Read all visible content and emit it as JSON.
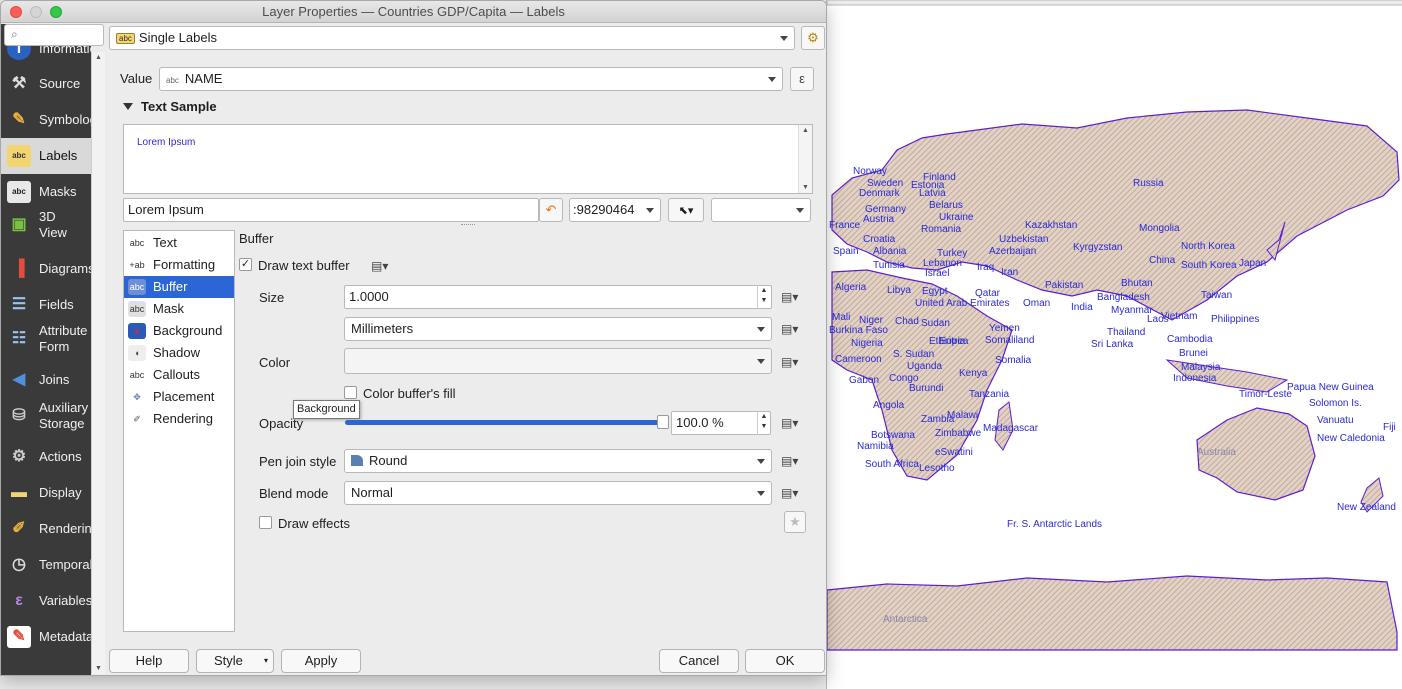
{
  "window": {
    "title": "Layer Properties — Countries GDP/Capita — Labels"
  },
  "sidebar": {
    "items": [
      {
        "label": "Information",
        "icon": "info-icon"
      },
      {
        "label": "Source",
        "icon": "wrench-icon"
      },
      {
        "label": "Symbology",
        "icon": "symbology-icon"
      },
      {
        "label": "Labels",
        "icon": "labels-abc-icon"
      },
      {
        "label": "Masks",
        "icon": "masks-abc-icon"
      },
      {
        "label": "3D",
        "label2": "View",
        "icon": "cube-3d-icon"
      },
      {
        "label": "Diagrams",
        "icon": "diagrams-icon"
      },
      {
        "label": "Fields",
        "icon": "fields-icon"
      },
      {
        "label": "Attribute",
        "label2": "Form",
        "icon": "form-icon"
      },
      {
        "label": "Joins",
        "icon": "joins-icon"
      },
      {
        "label": "Auxiliary",
        "label2": "Storage",
        "icon": "storage-icon"
      },
      {
        "label": "Actions",
        "icon": "actions-gear-icon"
      },
      {
        "label": "Display",
        "icon": "display-bubble-icon"
      },
      {
        "label": "Rendering",
        "icon": "paintbrush-icon"
      },
      {
        "label": "Temporal",
        "icon": "clock-icon"
      },
      {
        "label": "Variables",
        "icon": "epsilon-icon"
      },
      {
        "label": "Metadata",
        "icon": "metadata-icon"
      }
    ]
  },
  "labels_mode": {
    "value": "Single Labels"
  },
  "value_row": {
    "label": "Value",
    "field": "NAME"
  },
  "text_sample": {
    "heading": "Text Sample",
    "preview": "Lorem Ipsum",
    "input_value": "Lorem Ipsum",
    "scale_value": ":98290464"
  },
  "tabs": [
    {
      "label": "Text",
      "icon": "text-abc-icon"
    },
    {
      "label": "Formatting",
      "icon": "formatting-icon"
    },
    {
      "label": "Buffer",
      "icon": "buffer-abc-icon",
      "active": true
    },
    {
      "label": "Mask",
      "icon": "mask-abc-icon"
    },
    {
      "label": "Background",
      "icon": "background-icon"
    },
    {
      "label": "Shadow",
      "icon": "shadow-icon"
    },
    {
      "label": "Callouts",
      "icon": "callouts-icon"
    },
    {
      "label": "Placement",
      "icon": "placement-icon"
    },
    {
      "label": "Rendering",
      "icon": "rendering-brush-icon"
    }
  ],
  "tooltip": "Background",
  "buffer": {
    "heading": "Buffer",
    "draw_text_buffer": {
      "label": "Draw text buffer",
      "checked": true
    },
    "size": {
      "label": "Size",
      "value": "1.0000",
      "unit": "Millimeters"
    },
    "color": {
      "label": "Color"
    },
    "color_buffer_fill": {
      "label": "Color buffer's fill",
      "checked": false
    },
    "opacity": {
      "label": "Opacity",
      "value": "100.0 %",
      "level": 1.0
    },
    "pen_join": {
      "label": "Pen join style",
      "value": "Round"
    },
    "blend_mode": {
      "label": "Blend mode",
      "value": "Normal"
    },
    "draw_effects": {
      "label": "Draw effects",
      "checked": false
    }
  },
  "buttons": {
    "help": "Help",
    "style": "Style",
    "apply": "Apply",
    "cancel": "Cancel",
    "ok": "OK"
  },
  "map": {
    "labels": [
      "Norway",
      "Finland",
      "Sweden",
      "Estonia",
      "Denmark",
      "Latvia",
      "Germany",
      "Belarus",
      "Austria",
      "Ukraine",
      "France",
      "Romania",
      "Croatia",
      "Kazakhstan",
      "Uzbekistan",
      "Kyrgyzstan",
      "Mongolia",
      "Russia",
      "Albania",
      "Turkey",
      "Spain",
      "Tunisia",
      "Lebanon",
      "Azerbaijan",
      "Israel",
      "Iraq",
      "Iran",
      "North Korea",
      "China",
      "South Korea",
      "Japan",
      "Algeria",
      "Libya",
      "Egypt",
      "Pakistan",
      "Bhutan",
      "Qatar",
      "United Arab Emirates",
      "Oman",
      "Bangladesh",
      "Taiwan",
      "India",
      "Myanmar",
      "Mali",
      "Niger",
      "Chad",
      "Sudan",
      "Vietnam",
      "Philippines",
      "Burkina Faso",
      "Yemen",
      "Thailand",
      "Eritrea",
      "Somaliland",
      "Laos",
      "Nigeria",
      "Ethiopia",
      "Sri Lanka",
      "Cambodia",
      "S. Sudan",
      "Brunei",
      "Cameroon",
      "Somalia",
      "Uganda",
      "Malaysia",
      "Gabon",
      "Congo",
      "Kenya",
      "Indonesia",
      "Burundi",
      "Papua New Guinea",
      "Tanzania",
      "Timor-Leste",
      "Solomon Is.",
      "Angola",
      "Malawi",
      "Vanuatu",
      "Zambia",
      "Fiji",
      "Madagascar",
      "Zimbabwe",
      "Botswana",
      "New Caledonia",
      "Namibia",
      "eSwatini",
      "Australia",
      "South Africa",
      "Lesotho",
      "New Zealand",
      "Fr. S. Antarctic Lands",
      "Antarctica"
    ],
    "label_color": "#2a2ad6"
  },
  "colors": {
    "accent": "#2c65d6",
    "sidebar_bg": "#3a3a3a",
    "land_fill": "#d8c4b8",
    "land_outline": "#5b1fd1"
  }
}
